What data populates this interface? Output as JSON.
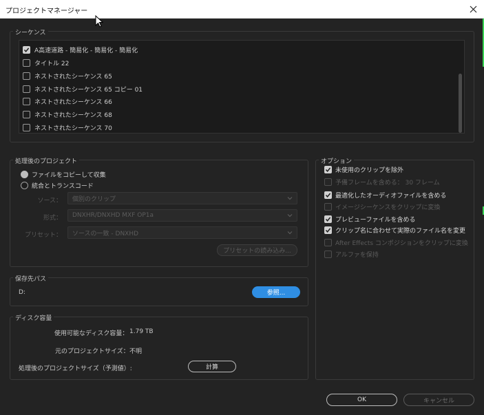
{
  "window": {
    "title": "プロジェクトマネージャー"
  },
  "sequences": {
    "group_title": "シーケンス",
    "items": [
      {
        "label": "A高速道路 - 簡易化 - 簡易化 - 簡易化",
        "checked": true
      },
      {
        "label": "タイトル 22",
        "checked": false
      },
      {
        "label": "ネストされたシーケンス 65",
        "checked": false
      },
      {
        "label": "ネストされたシーケンス 65 コピー 01",
        "checked": false
      },
      {
        "label": "ネストされたシーケンス 66",
        "checked": false
      },
      {
        "label": "ネストされたシーケンス 68",
        "checked": false
      },
      {
        "label": "ネストされたシーケンス 70",
        "checked": false
      }
    ]
  },
  "processed_project": {
    "group_title": "処理後のプロジェクト",
    "radio_copy": "ファイルをコピーして収集",
    "radio_consolidate": "統合とトランスコード",
    "source_label": "ソース：",
    "source_value": "個別のクリップ",
    "format_label": "形式：",
    "format_value": "DNXHR/DNXHD MXF OP1a",
    "preset_label": "プリセット：",
    "preset_value": "ソースの一致 - DNXHD",
    "import_preset_button": "プリセットの読み込み..."
  },
  "options": {
    "group_title": "オプション",
    "items": [
      {
        "label": "未使用のクリップを除外",
        "checked": true,
        "enabled": true
      },
      {
        "label": "予備フレームを含める： 30 フレーム",
        "checked": false,
        "enabled": false
      },
      {
        "label": "最適化したオーディオファイルを含める",
        "checked": true,
        "enabled": true
      },
      {
        "label": "イメージシーケンスをクリップに変換",
        "checked": false,
        "enabled": false
      },
      {
        "label": "プレビューファイルを含める",
        "checked": true,
        "enabled": true
      },
      {
        "label": "クリップ名に合わせて実際のファイル名を変更",
        "checked": true,
        "enabled": true
      },
      {
        "label": "After Effects コンポジションをクリップに変換",
        "checked": false,
        "enabled": false
      },
      {
        "label": "アルファを保持",
        "checked": false,
        "enabled": false
      }
    ]
  },
  "destination": {
    "group_title": "保存先パス",
    "path": "D:",
    "browse_button": "参照..."
  },
  "disk": {
    "group_title": "ディスク容量",
    "available_label": "使用可能なディスク容量：",
    "available_value": "1.79 TB",
    "original_label": "元のプロジェクトサイズ：",
    "original_value": "不明",
    "processed_label": "処理後のプロジェクトサイズ（予測値）:",
    "calc_button": "計算"
  },
  "footer": {
    "ok": "OK",
    "cancel": "キャンセル"
  }
}
